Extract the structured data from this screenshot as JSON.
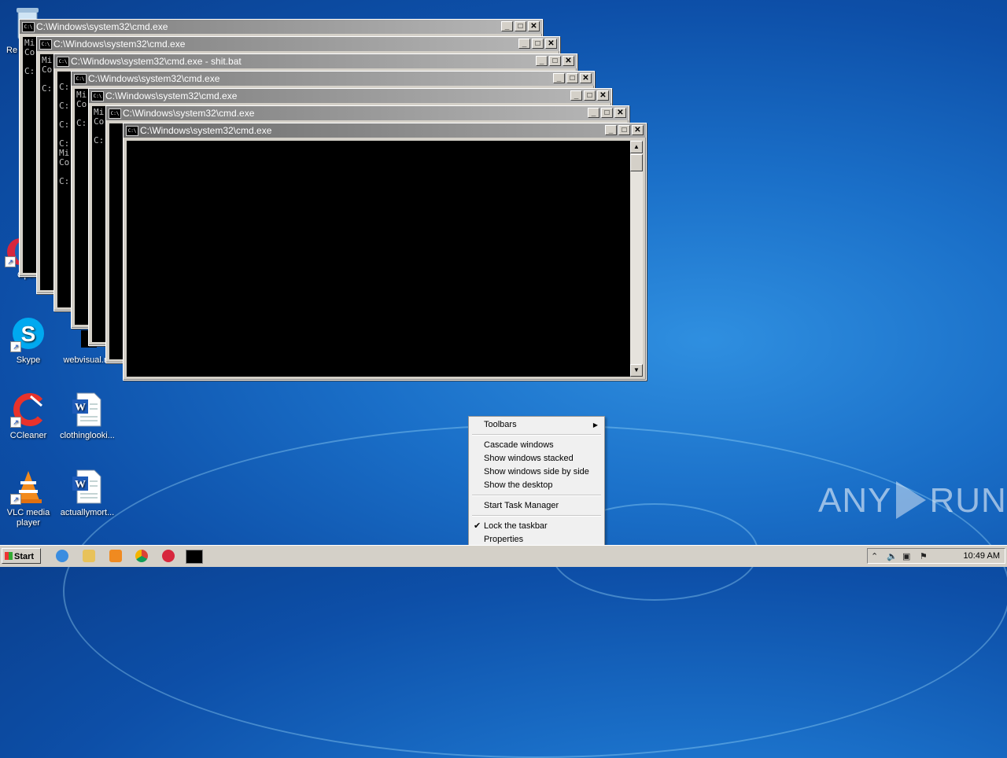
{
  "desktop": {
    "icons": [
      {
        "label": "Re",
        "name": "recycle-bin-icon"
      },
      {
        "label": "Oper",
        "name": "opera-icon"
      },
      {
        "label": "Skype",
        "name": "skype-icon"
      },
      {
        "label": "webvisual.r",
        "name": "webvisual-icon"
      },
      {
        "label": "CCleaner",
        "name": "ccleaner-icon"
      },
      {
        "label": "clothinglooki...",
        "name": "word-doc-icon"
      },
      {
        "label": "VLC media player",
        "name": "vlc-icon"
      },
      {
        "label": "actuallymort...",
        "name": "word-doc-icon"
      }
    ]
  },
  "windows": [
    {
      "title": "C:\\Windows\\system32\\cmd.exe",
      "console": "Mi\nCo\n\nC:"
    },
    {
      "title": "C:\\Windows\\system32\\cmd.exe",
      "console": "Mi\nCo\n\nC:"
    },
    {
      "title": "C:\\Windows\\system32\\cmd.exe - shit.bat",
      "console": "\nC:\n\nC:\n\nC:\n\nC:\nMi\nCo\n\nC:"
    },
    {
      "title": "C:\\Windows\\system32\\cmd.exe",
      "console": "Mi\nCo\n\nC:"
    },
    {
      "title": "C:\\Windows\\system32\\cmd.exe",
      "console": "Mi\nCo\n\nC:"
    },
    {
      "title": "C:\\Windows\\system32\\cmd.exe",
      "console": ""
    },
    {
      "title": "C:\\Windows\\system32\\cmd.exe",
      "console": ""
    }
  ],
  "window_buttons": {
    "minimize": "_",
    "maximize": "□",
    "close": "✕"
  },
  "context_menu": {
    "items": [
      {
        "label": "Toolbars",
        "submenu": "▶"
      },
      {
        "label": "Cascade windows"
      },
      {
        "label": "Show windows stacked"
      },
      {
        "label": "Show windows side by side"
      },
      {
        "label": "Show the desktop"
      },
      {
        "label": "Start Task Manager"
      },
      {
        "label": "Lock the taskbar",
        "check": "✔"
      },
      {
        "label": "Properties"
      }
    ]
  },
  "taskbar": {
    "start_label": "Start",
    "clock": "10:49 AM",
    "tray_up_arrow": "⌃"
  },
  "watermark": {
    "left": "ANY",
    "right": "RUN"
  }
}
